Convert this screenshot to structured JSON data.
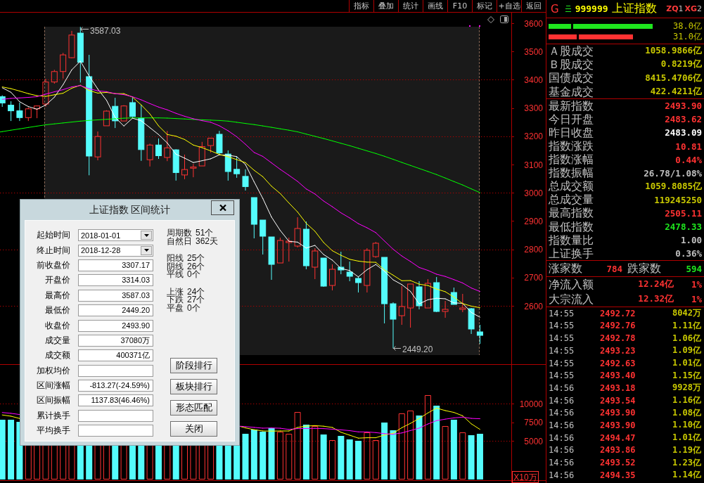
{
  "toolbar": {
    "buttons": [
      "指标",
      "叠加",
      "统计",
      "画线",
      "F10",
      "标记",
      "+自选",
      "返回"
    ]
  },
  "price_chart": {
    "axis_labels": [
      "3600",
      "3500",
      "3400",
      "3300",
      "3200",
      "3100",
      "3000",
      "2900",
      "2800",
      "2700",
      "2600"
    ],
    "high_label": "3587.03",
    "low_label": "2449.20"
  },
  "stats_dialog": {
    "title": "上证指数 区间统计",
    "fields": [
      {
        "label": "起始时间",
        "value": "2018-01-01",
        "kind": "date"
      },
      {
        "label": "终止时间",
        "value": "2018-12-28",
        "kind": "date"
      },
      {
        "label": "前收盘价",
        "value": "3307.17",
        "kind": "text"
      },
      {
        "label": "开盘价",
        "value": "3314.03",
        "kind": "text"
      },
      {
        "label": "最高价",
        "value": "3587.03",
        "kind": "text"
      },
      {
        "label": "最低价",
        "value": "2449.20",
        "kind": "text"
      },
      {
        "label": "收盘价",
        "value": "2493.90",
        "kind": "text"
      },
      {
        "label": "成交量",
        "value": "37080万",
        "kind": "text"
      },
      {
        "label": "成交额",
        "value": "400371亿",
        "kind": "text"
      },
      {
        "label": "加权均价",
        "kind": "text"
      },
      {
        "label": "区间涨幅",
        "value": "-813.27(-24.59%)",
        "kind": "text"
      },
      {
        "label": "区间振幅",
        "value": "1137.83(46.46%)",
        "kind": "text"
      },
      {
        "label": "累计换手",
        "kind": "text"
      },
      {
        "label": "平均换手",
        "kind": "text"
      }
    ],
    "summary": [
      [
        {
          "label": "周期数",
          "value": "51个"
        },
        {
          "label": "自然日",
          "value": "362天"
        }
      ],
      [
        {
          "label": "阳线",
          "value": "25个"
        },
        {
          "label": "阴线",
          "value": "26个"
        },
        {
          "label": "平线",
          "value": "0个"
        }
      ],
      [
        {
          "label": "上涨",
          "value": "24个"
        },
        {
          "label": "下跌",
          "value": "27个"
        },
        {
          "label": "平盘",
          "value": "0个"
        }
      ]
    ],
    "buttons": [
      "阶段排行",
      "板块排行",
      "形态匹配",
      "关闭"
    ]
  },
  "volume_chart": {
    "axis_labels": [
      "10000",
      "7500",
      "5000"
    ],
    "unit": "X10万"
  },
  "quote_panel": {
    "flag": "G",
    "code": "999999",
    "name": "上证指数",
    "tags": [
      {
        "label": "ZQ",
        "count": "1"
      },
      {
        "label": "XG",
        "count": "2"
      }
    ],
    "flow_bars": [
      {
        "color": "#1ee61e",
        "segments": [
          {
            "level": 0.1829
          },
          {
            "level": 0.8071
          }
        ],
        "reading": "38.0亿"
      },
      {
        "color": "#ff3232",
        "segments": [
          {
            "level": 0.2286
          },
          {
            "level": 0.5833
          }
        ],
        "reading": "31.0亿"
      }
    ],
    "turnover": [
      {
        "label": "Ａ股成交",
        "value": "1058.9866亿"
      },
      {
        "label": "Ｂ股成交",
        "value": "0.8219亿"
      },
      {
        "label": "国债成交",
        "value": "8415.4706亿"
      },
      {
        "label": "基金成交",
        "value": "422.4211亿"
      }
    ],
    "index_stats": [
      {
        "label": "最新指数",
        "value": "2493.90",
        "color": "#ff3232"
      },
      {
        "label": "今日开盘",
        "value": "2483.62",
        "color": "#ff3232"
      },
      {
        "label": "昨日收盘",
        "value": "2483.09",
        "color": "#ffffff"
      },
      {
        "label": "指数涨跌",
        "value": "10.81",
        "color": "#ff3232"
      },
      {
        "label": "指数涨幅",
        "value": "0.44%",
        "color": "#ff3232"
      },
      {
        "label": "指数振幅",
        "value": "26.78/1.08%",
        "color": "#c0c0c0"
      },
      {
        "label": "总成交额",
        "value": "1059.8085亿",
        "color": "#c8c800"
      },
      {
        "label": "总成交量",
        "value": "119245250",
        "color": "#c8c800"
      },
      {
        "label": "最高指数",
        "value": "2505.11",
        "color": "#ff3232"
      },
      {
        "label": "最低指数",
        "value": "2478.33",
        "color": "#1ee61e"
      },
      {
        "label": "指数量比",
        "value": "1.00",
        "color": "#c0c0c0"
      },
      {
        "label": "上证换手",
        "value": "0.36%",
        "color": "#c0c0c0"
      }
    ],
    "breadth": [
      {
        "label": "涨家数",
        "value": "784",
        "color": "#ff3232"
      },
      {
        "label": "跌家数",
        "value": "594",
        "color": "#1ee61e"
      }
    ],
    "fund_flows": [
      {
        "label": "净流入额",
        "value": "12.24亿",
        "share": "1%"
      },
      {
        "label": "大宗流入",
        "value": "12.32亿",
        "share": "1%"
      }
    ],
    "ticks": [
      {
        "time": "14:55",
        "price": "2492.72",
        "volume": "8042万"
      },
      {
        "time": "14:55",
        "price": "2492.76",
        "volume": "1.11亿"
      },
      {
        "time": "14:55",
        "price": "2492.78",
        "volume": "1.06亿"
      },
      {
        "time": "14:55",
        "price": "2493.23",
        "volume": "1.09亿"
      },
      {
        "time": "14:55",
        "price": "2492.63",
        "volume": "1.01亿"
      },
      {
        "time": "14:55",
        "price": "2493.40",
        "volume": "1.15亿"
      },
      {
        "time": "14:56",
        "price": "2493.18",
        "volume": "9928万"
      },
      {
        "time": "14:56",
        "price": "2493.54",
        "volume": "1.16亿"
      },
      {
        "time": "14:56",
        "price": "2493.90",
        "volume": "1.08亿"
      },
      {
        "time": "14:56",
        "price": "2493.90",
        "volume": "1.10亿"
      },
      {
        "time": "14:56",
        "price": "2494.47",
        "volume": "1.01亿"
      },
      {
        "time": "14:56",
        "price": "2493.86",
        "volume": "1.19亿"
      },
      {
        "time": "14:56",
        "price": "2493.52",
        "volume": "1.23亿"
      },
      {
        "time": "14:56",
        "price": "2494.35",
        "volume": "1.14亿"
      }
    ]
  }
}
